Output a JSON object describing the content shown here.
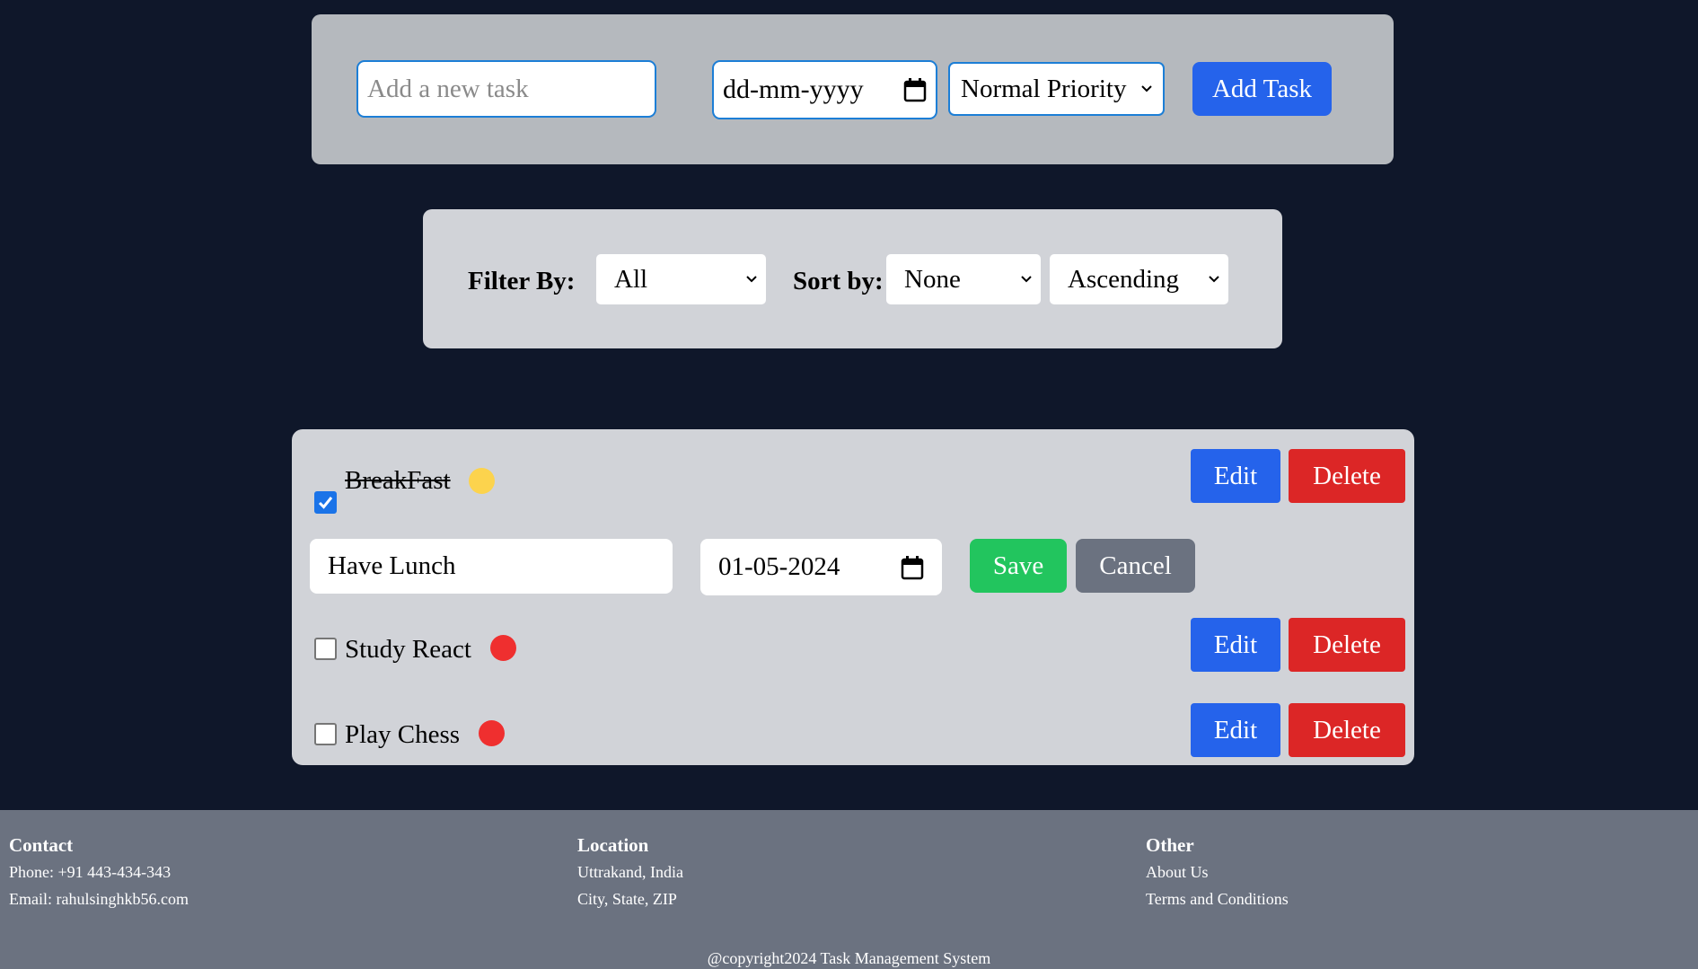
{
  "add_task": {
    "placeholder": "Add a new task",
    "date_placeholder": "dd-mm-yyyy",
    "priority_selected": "Normal Priority",
    "add_label": "Add Task"
  },
  "filter": {
    "filter_label": "Filter By:",
    "filter_value": "All",
    "sort_label": "Sort by:",
    "sort_value": "None",
    "order_value": "Ascending"
  },
  "tasks": [
    {
      "title": "BreakFast",
      "completed": true,
      "priority_color": "#fcd34d",
      "edit_label": "Edit",
      "delete_label": "Delete"
    },
    {
      "editing": true,
      "title_value": "Have Lunch",
      "date_value": "01-05-2024",
      "save_label": "Save",
      "cancel_label": "Cancel"
    },
    {
      "title": "Study React",
      "completed": false,
      "priority_color": "#ef2f2f",
      "edit_label": "Edit",
      "delete_label": "Delete"
    },
    {
      "title": "Play Chess",
      "completed": false,
      "priority_color": "#ef2f2f",
      "edit_label": "Edit",
      "delete_label": "Delete"
    }
  ],
  "footer": {
    "contact": {
      "heading": "Contact",
      "phone": "Phone: +91 443-434-343",
      "email": "Email: rahulsinghkb56.com"
    },
    "location": {
      "heading": "Location",
      "line1": "Uttrakand, India",
      "line2": "City, State, ZIP"
    },
    "other": {
      "heading": "Other",
      "about": "About Us",
      "terms": "Terms and Conditions"
    },
    "copyright": "@copyright2024 Task Management System"
  },
  "colors": {
    "background": "#0f172a",
    "primary": "#2563eb",
    "danger": "#dc2626",
    "success": "#22c55e",
    "secondary": "#6b7280"
  },
  "icons": [
    "calendar-icon",
    "chevron-down-icon",
    "checkmark-icon"
  ]
}
